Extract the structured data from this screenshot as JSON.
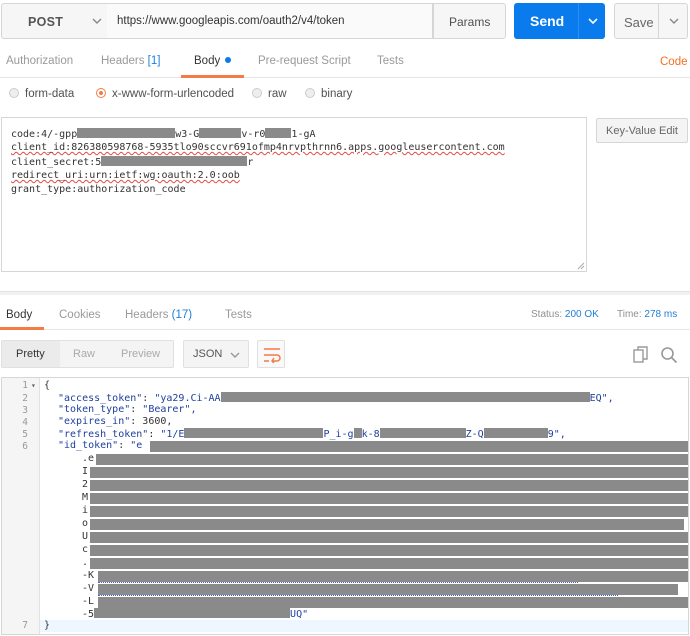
{
  "request": {
    "method": "POST",
    "url": "https://www.googleapis.com/oauth2/v4/token",
    "params_label": "Params",
    "send_label": "Send",
    "save_label": "Save"
  },
  "request_tabs": {
    "authorization": "Authorization",
    "headers": "Headers",
    "headers_count": "[1]",
    "body": "Body",
    "prerequest": "Pre-request Script",
    "tests": "Tests",
    "code": "Code"
  },
  "body_types": [
    "form-data",
    "x-www-form-urlencoded",
    "raw",
    "binary"
  ],
  "body_type_selected": "x-www-form-urlencoded",
  "body_lines": {
    "code_a": "code:4/-gpp",
    "code_b": "w3-G",
    "code_c": "v-r0",
    "code_d": "1-gA",
    "client_id": "client_id:826380598768-5935tlo90sccvr691ofmp4nrvpthrnn6.apps.googleusercontent.com",
    "client_secret_a": "client_secret:5",
    "client_secret_b": "r",
    "redirect_uri": "redirect_uri:urn:ietf:wg:oauth:2.0:oob",
    "grant_type": "grant_type:authorization_code"
  },
  "kv_edit_label": "Key-Value Edit",
  "response_tabs": {
    "body": "Body",
    "cookies": "Cookies",
    "headers": "Headers",
    "headers_count": "(17)",
    "tests": "Tests"
  },
  "status": {
    "status_label": "Status:",
    "status_value": "200 OK",
    "time_label": "Time:",
    "time_value": "278 ms"
  },
  "view_modes": [
    "Pretty",
    "Raw",
    "Preview"
  ],
  "format_select": "JSON",
  "response": {
    "line_numbers": [
      "1",
      "2",
      "3",
      "4",
      "5",
      "6",
      "",
      "",
      "",
      "",
      "",
      "",
      "",
      "",
      "",
      "",
      "",
      "7"
    ],
    "open_brace": "{",
    "access_token_key": "\"access_token\"",
    "access_token_a": "\"ya29.Ci-AA",
    "access_token_b": "EQ\",",
    "token_type_key": "\"token_type\"",
    "token_type_val": "\"Bearer\",",
    "expires_in_key": "\"expires_in\"",
    "expires_in_val": "3600,",
    "refresh_token_key": "\"refresh_token\"",
    "refresh_token_a": "\"1/E",
    "refresh_token_b": "P_i-g",
    "refresh_token_c": "k-8",
    "refresh_token_d": "Z-Q",
    "refresh_token_e": "9\",",
    "id_token_key": "\"id_token\"",
    "id_token_a": "\"e",
    "id_token_lines": [
      ".e",
      "I",
      "2",
      "M",
      "i",
      "o",
      "U",
      "c",
      ".",
      "-K",
      "-V",
      "-L",
      "-5"
    ],
    "id_token_end": "UQ\"",
    "close_brace": "}"
  },
  "colors": {
    "send": "#097bed",
    "accent": "#f37b45",
    "link": "#1e7fd8",
    "code_key": "#1e3f9e",
    "redaction": "#8a8a8a"
  }
}
